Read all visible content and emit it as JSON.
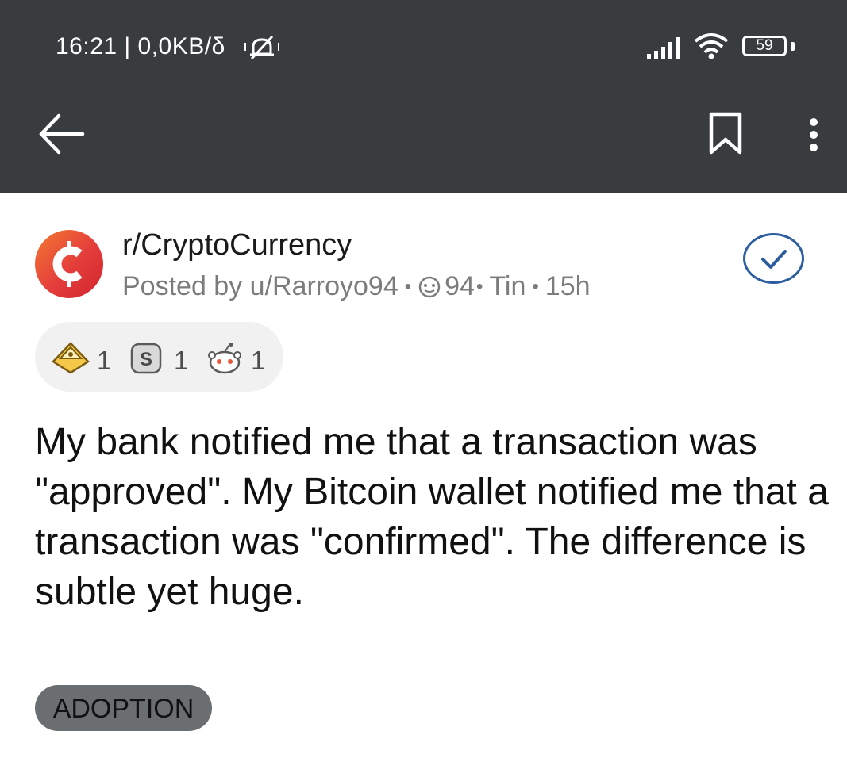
{
  "status_bar": {
    "time_speed": "16:21 | 0,0KB/δ",
    "battery": "59"
  },
  "toolbar": {
    "back_icon": "arrow-left-icon",
    "bookmark_icon": "bookmark-icon",
    "more_icon": "more-vertical-icon"
  },
  "post": {
    "subreddit": "r/CryptoCurrency",
    "posted_by": "Posted by u/Rarroyo94",
    "karma": "94",
    "flag": "Tin",
    "age": "15h",
    "awards": [
      {
        "icon": "helpful-award-icon",
        "count": "1"
      },
      {
        "icon": "silver-award-icon",
        "count": "1"
      },
      {
        "icon": "wholesome-award-icon",
        "count": "1"
      }
    ],
    "title": "My bank notified me that a transaction was \"approved\". My Bitcoin wallet notified me that a transaction was \"confirmed\". The difference is subtle yet huge.",
    "flair": "ADOPTION"
  },
  "colors": {
    "top_bar": "#383c3f",
    "avatar_gradient_start": "#f37a32",
    "avatar_gradient_end": "#d1242f",
    "joined_accent": "#2c5d9e",
    "flair_bg": "#6b6e71"
  }
}
